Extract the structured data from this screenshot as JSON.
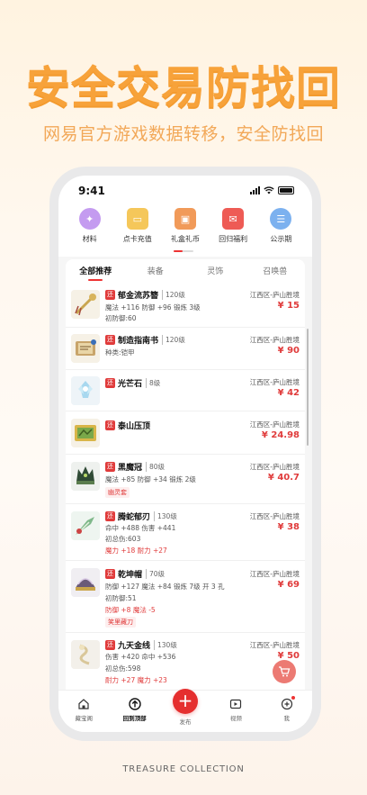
{
  "promo": {
    "headline": "安全交易防找回",
    "subline": "网易官方游戏数据转移，安全防找回",
    "footer": "TREASURE COLLECTION"
  },
  "status": {
    "time": "9:41"
  },
  "categories": [
    {
      "label": "材料",
      "icon": "crystal-icon",
      "color": "#c49bf0"
    },
    {
      "label": "点卡充值",
      "icon": "card-icon",
      "color": "#f5c75a"
    },
    {
      "label": "礼盒礼币",
      "icon": "gift-icon",
      "color": "#f19a59"
    },
    {
      "label": "回归福利",
      "icon": "red-envelope-icon",
      "color": "#ee5b55"
    },
    {
      "label": "公示期",
      "icon": "notice-icon",
      "color": "#7cb1ef"
    }
  ],
  "tabs": [
    "全部推荐",
    "装备",
    "灵饰",
    "召唤兽"
  ],
  "items": [
    {
      "tag": "还",
      "name": "郁金流苏簪",
      "level": "120级",
      "attrs": [
        "魔法 +116 防御 +96 锻炼 3级",
        "初防御:60"
      ],
      "red_attr": "",
      "chip": "",
      "server": "江西区-庐山胜境",
      "price": "¥ 15"
    },
    {
      "tag": "还",
      "name": "制造指南书",
      "level": "120级",
      "attrs": [
        "种类:铠甲"
      ],
      "red_attr": "",
      "chip": "",
      "server": "江西区-庐山胜境",
      "price": "¥ 90"
    },
    {
      "tag": "还",
      "name": "光芒石",
      "level": "8级",
      "attrs": [],
      "red_attr": "",
      "chip": "",
      "server": "江西区-庐山胜境",
      "price": "¥ 42"
    },
    {
      "tag": "还",
      "name": "泰山压顶",
      "level": "",
      "attrs": [],
      "red_attr": "",
      "chip": "",
      "server": "江西区-庐山胜境",
      "price": "¥ 24.98"
    },
    {
      "tag": "还",
      "name": "黑魔冠",
      "level": "80级",
      "attrs": [
        "魔法 +85 防御 +34 锻炼 2级"
      ],
      "red_attr": "",
      "chip": "幽灵套",
      "server": "江西区-庐山胜境",
      "price": "¥ 40.7"
    },
    {
      "tag": "还",
      "name": "腾蛇郁刃",
      "level": "130级",
      "attrs": [
        "命中 +488 伤害 +441",
        "初总伤:603"
      ],
      "red_attr": "魔力 +18 耐力 +27",
      "chip": "",
      "server": "江西区-庐山胜境",
      "price": "¥ 38"
    },
    {
      "tag": "还",
      "name": "乾坤帽",
      "level": "70级",
      "attrs": [
        "防御 +127 魔法 +84 锻炼 7级 开 3 孔",
        "初防御:51"
      ],
      "red_attr": "防御 +8 魔法 -5",
      "chip": "笑里藏刀",
      "server": "江西区-庐山胜境",
      "price": "¥ 69"
    },
    {
      "tag": "还",
      "name": "九天金线",
      "level": "130级",
      "attrs": [
        "伤害 +420 命中 +536",
        "初总伤:598"
      ],
      "red_attr": "耐力 +27 魔力 +23",
      "chip": "",
      "server": "江西区-庐山胜境",
      "price": "¥ 50"
    }
  ],
  "bottom_nav": [
    {
      "label": "藏宝阁",
      "icon": "home-icon"
    },
    {
      "label": "回到顶部",
      "icon": "back-to-top-icon"
    },
    {
      "label": "发布",
      "icon": "plus-icon"
    },
    {
      "label": "视频",
      "icon": "video-icon"
    },
    {
      "label": "我",
      "icon": "profile-icon"
    }
  ]
}
